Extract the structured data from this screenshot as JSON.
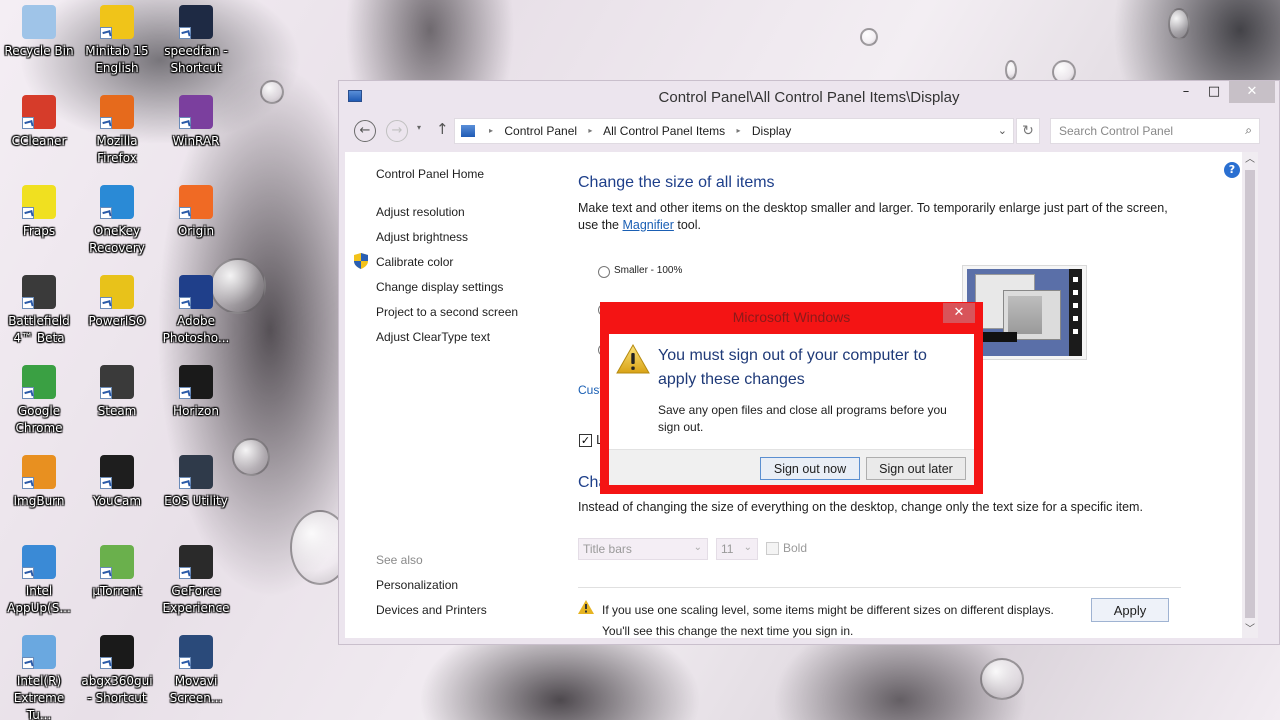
{
  "desktop": {
    "icons": [
      {
        "label": "Recycle Bin",
        "color": "#9fc4e8"
      },
      {
        "label": "Minitab 15 English",
        "color": "#f0c419"
      },
      {
        "label": "speedfan - Shortcut",
        "color": "#1e2a44"
      },
      {
        "label": "CCleaner",
        "color": "#d63c2a"
      },
      {
        "label": "Mozilla Firefox",
        "color": "#e66a1c"
      },
      {
        "label": "WinRAR",
        "color": "#7b3f9e"
      },
      {
        "label": "Fraps",
        "color": "#f0e020"
      },
      {
        "label": "OneKey Recovery",
        "color": "#2a8ad6"
      },
      {
        "label": "Origin",
        "color": "#f06a24"
      },
      {
        "label": "Battlefield 4™ Beta",
        "color": "#3a3a3a"
      },
      {
        "label": "PowerISO",
        "color": "#e8c21a"
      },
      {
        "label": "Adobe Photosho...",
        "color": "#1f3f8a"
      },
      {
        "label": "Google Chrome",
        "color": "#3aa043"
      },
      {
        "label": "Steam",
        "color": "#3a3a3a"
      },
      {
        "label": "Horizon",
        "color": "#1a1a1a"
      },
      {
        "label": "ImgBurn",
        "color": "#e89020"
      },
      {
        "label": "YouCam",
        "color": "#1e1e1e"
      },
      {
        "label": "EOS Utility",
        "color": "#2f3a4a"
      },
      {
        "label": "Intel AppUp(S...",
        "color": "#3a8ad6"
      },
      {
        "label": "µTorrent",
        "color": "#6ab04c"
      },
      {
        "label": "GeForce Experience",
        "color": "#2a2a2a"
      },
      {
        "label": "Intel(R) Extreme Tu...",
        "color": "#6aa8e0"
      },
      {
        "label": "abgx360gui - Shortcut",
        "color": "#1a1a1a"
      },
      {
        "label": "Movavi Screen...",
        "color": "#2a4a7a"
      }
    ]
  },
  "window": {
    "title": "Control Panel\\All Control Panel Items\\Display",
    "controls": {
      "minimize": "–",
      "maximize": "□",
      "close": "✕"
    },
    "nav": {
      "back": "←",
      "forward": "→",
      "recent": "▾",
      "up": "↑"
    },
    "breadcrumb": [
      "Control Panel",
      "All Control Panel Items",
      "Display"
    ],
    "breadcrumb_sep": "▸",
    "address_dropdown": "⌄",
    "refresh": "↻",
    "search": {
      "placeholder": "Search Control Panel",
      "value": "",
      "icon": "⌕"
    },
    "help": "?"
  },
  "sidebar": {
    "home": "Control Panel Home",
    "links": [
      "Adjust resolution",
      "Adjust brightness",
      "Calibrate color",
      "Change display settings",
      "Project to a second screen",
      "Adjust ClearType text"
    ],
    "see_also_label": "See also",
    "see_also": [
      "Personalization",
      "Devices and Printers"
    ]
  },
  "main": {
    "section1_title": "Change the size of all items",
    "section1_desc_before": "Make text and other items on the desktop smaller and larger. To temporarily enlarge just part of the screen, use the ",
    "magnifier_link": "Magnifier",
    "section1_desc_after": " tool.",
    "size_options": [
      {
        "label": "Smaller - 100%",
        "selected": false
      }
    ],
    "custom_link_partial": "Cust",
    "checkbox_partial": "L",
    "checkbox_checked": true,
    "section2_title_partial": "Cha",
    "section2_desc": "Instead of changing the size of everything on the desktop, change only the text size for a specific item.",
    "item_select": {
      "value": "Title bars"
    },
    "size_select": {
      "value": "11"
    },
    "bold_label": "Bold",
    "bold_checked": false,
    "warning_line1": "If you use one scaling level, some items might be different sizes on different displays.",
    "warning_line2": "You'll see this change the next time you sign in.",
    "apply_label": "Apply"
  },
  "dialog": {
    "title": "Microsoft Windows",
    "close": "✕",
    "heading": "You must sign out of your computer to apply these changes",
    "message": "Save any open files and close all programs before you sign out.",
    "primary_button": "Sign out now",
    "secondary_button": "Sign out later",
    "accent_color": "#f41414"
  }
}
